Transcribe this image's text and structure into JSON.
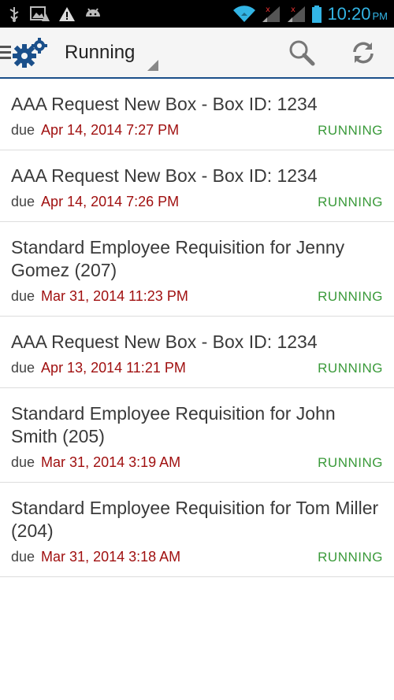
{
  "status_bar": {
    "time": "10:20",
    "ampm": "PM"
  },
  "action_bar": {
    "title": "Running"
  },
  "items": [
    {
      "title": "AAA Request New Box - Box ID: 1234",
      "due_label": "due",
      "due": "Apr 14, 2014 7:27 PM",
      "status": "RUNNING"
    },
    {
      "title": "AAA Request New Box - Box ID: 1234",
      "due_label": "due",
      "due": "Apr 14, 2014 7:26 PM",
      "status": "RUNNING"
    },
    {
      "title": "Standard Employee Requisition for Jenny Gomez (207)",
      "due_label": "due",
      "due": "Mar 31, 2014 11:23 PM",
      "status": "RUNNING"
    },
    {
      "title": "AAA Request New Box - Box ID: 1234",
      "due_label": "due",
      "due": "Apr 13, 2014 11:21 PM",
      "status": "RUNNING"
    },
    {
      "title": "Standard Employee Requisition for John Smith (205)",
      "due_label": "due",
      "due": "Mar 31, 2014 3:19 AM",
      "status": "RUNNING"
    },
    {
      "title": "Standard Employee Requisition for Tom Miller (204)",
      "due_label": "due",
      "due": "Mar 31, 2014 3:18 AM",
      "status": "RUNNING"
    }
  ],
  "colors": {
    "accent": "#1a4f8a",
    "due_date": "#a01010",
    "status_running": "#3a9a3a",
    "clock": "#33b5e5"
  }
}
